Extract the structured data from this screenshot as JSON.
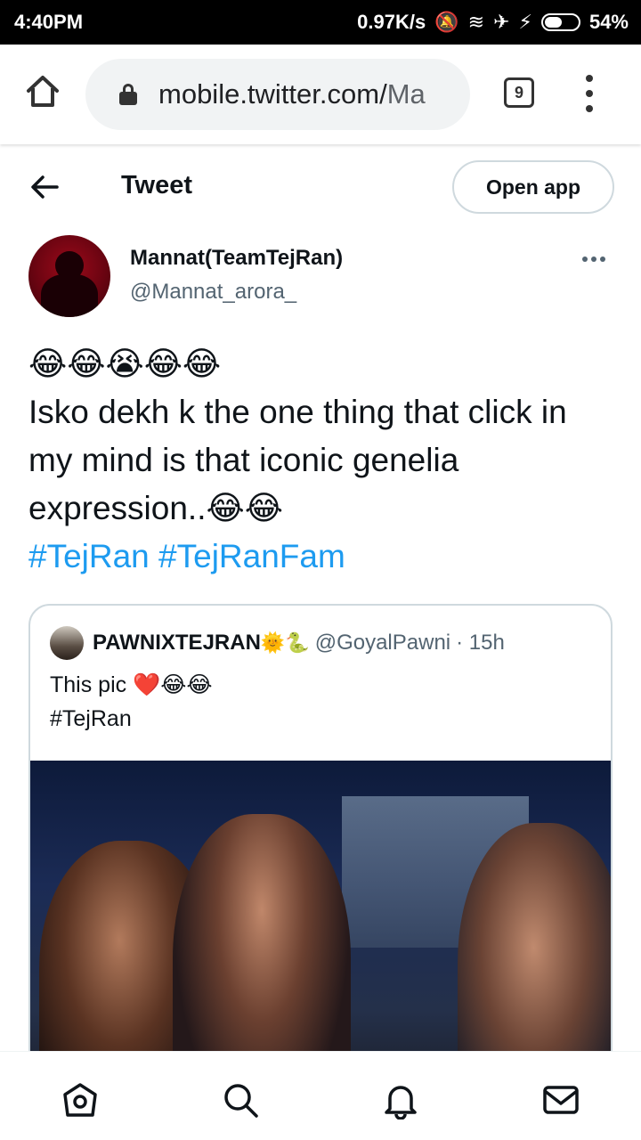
{
  "status_bar": {
    "time": "4:40PM",
    "network_speed": "0.97K/s",
    "battery_percent": "54%",
    "battery_level": 0.54
  },
  "browser": {
    "url_host": "mobile.twitter.com/",
    "url_rest": "Ma",
    "tab_count": "9"
  },
  "header": {
    "title": "Tweet",
    "open_app_label": "Open app"
  },
  "tweet": {
    "author_name": "Mannat(TeamTejRan)",
    "author_handle": "@Mannat_arora_",
    "emoji_line": "😂😂😭😂😂",
    "text": "Isko dekh k the one thing that click in my mind is that iconic genelia expression..",
    "text_emoji": "😂😂",
    "hashtag_1": "#TejRan",
    "hashtag_2": "#TejRanFam"
  },
  "quoted_tweet": {
    "author_name": "PAWNIXTEJRAN",
    "name_emoji": "🌞🐍",
    "author_handle": "@GoyalPawni",
    "time": "· 15h",
    "text": "This pic",
    "text_emoji": "❤️😂😂",
    "hashtag": "#TejRan"
  },
  "bottom_nav": {
    "items": [
      "home-icon",
      "search-icon",
      "notifications-icon",
      "messages-icon"
    ]
  }
}
